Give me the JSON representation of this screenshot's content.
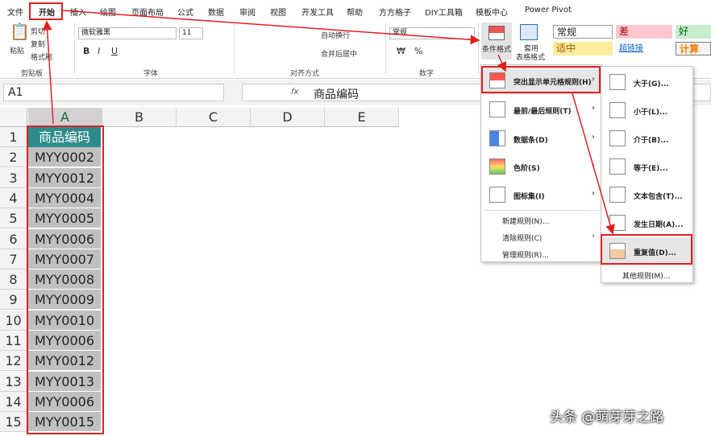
{
  "tabs": [
    "文件",
    "开始",
    "插入",
    "绘图",
    "页面布局",
    "公式",
    "数据",
    "审阅",
    "视图",
    "开发工具",
    "帮助",
    "方方格子",
    "DIY工具箱",
    "模板中心",
    "Power Pivot"
  ],
  "ribbon": {
    "clipboard": {
      "paste": "粘贴",
      "cut": "剪切",
      "copy": "复制",
      "format_painter": "格式刷",
      "group": "剪贴板"
    },
    "font": {
      "name": "微软雅黑",
      "size": "11",
      "bold": "B",
      "italic": "I",
      "underline": "U",
      "group": "字体"
    },
    "alignment": {
      "wrap": "自动换行",
      "merge": "合并后居中",
      "group": "对齐方式"
    },
    "number": {
      "format": "常规",
      "group": "数字"
    },
    "cond_format": "条件格式",
    "table_format_1": "套用",
    "table_format_2": "表格格式",
    "styles": {
      "normal": "常规",
      "bad": "差",
      "good": "好",
      "neutral": "适中",
      "hyperlink": "超链接",
      "calc": "计算"
    }
  },
  "formula_bar": {
    "name_box": "A1",
    "content": "商品编码",
    "fx": "fx"
  },
  "columns": [
    "A",
    "B",
    "C",
    "D",
    "E"
  ],
  "rows": [
    "1",
    "2",
    "3",
    "4",
    "5",
    "6",
    "7",
    "8",
    "9",
    "10",
    "11",
    "12",
    "13",
    "14",
    "15"
  ],
  "cells": [
    "商品编码",
    "MYY0002",
    "MYY0012",
    "MYY0004",
    "MYY0005",
    "MYY0006",
    "MYY0007",
    "MYY0008",
    "MYY0009",
    "MYY0010",
    "MYY0006",
    "MYY0012",
    "MYY0013",
    "MYY0006",
    "MYY0015"
  ],
  "cf_menu": [
    "突出显示单元格规则(H)",
    "最前/最后规则(T)",
    "数据条(D)",
    "色阶(S)",
    "图标集(I)",
    "新建规则(N)...",
    "清除规则(C)",
    "管理规则(R)..."
  ],
  "sub_menu": [
    "大于(G)...",
    "小于(L)...",
    "介于(B)...",
    "等于(E)...",
    "文本包含(T)...",
    "发生日期(A)...",
    "重复值(D)...",
    "其他规则(M)..."
  ],
  "watermark": "头条 @萌芽芽之路",
  "colors": {
    "header_fill": "#2e8b8b",
    "cell_fill": "#c0c0c0",
    "highlight": "#e02020",
    "grid_header": "#217346"
  }
}
